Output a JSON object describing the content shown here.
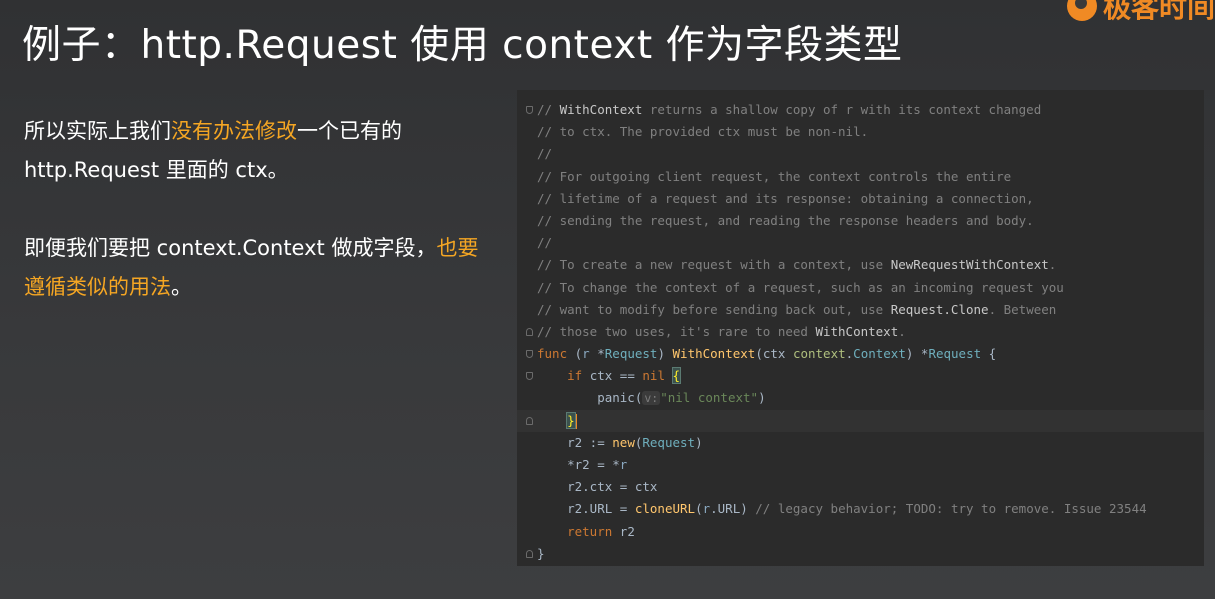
{
  "slide": {
    "title": "例子：http.Request 使用 context 作为字段类型",
    "logo_text": "极客时间"
  },
  "left": {
    "p1_a": "所以实际上我们",
    "p1_hl": "没有办法修改",
    "p1_b": "一个已有的 http.Request 里面的 ctx。",
    "p2_a": "即便我们要把 context.Context 做成字段，",
    "p2_hl": "也要遵循类似的用法",
    "p2_b": "。"
  },
  "colors": {
    "highlight": "#f5a623",
    "logo": "#f08a24",
    "code_bg": "#2b2b2b",
    "comment": "#808080",
    "keyword": "#cc7832",
    "type": "#6fafbd",
    "function": "#ffc66d",
    "string": "#6a8759"
  },
  "code": {
    "lines": [
      {
        "fold": "start",
        "current": false,
        "tokens": [
          {
            "t": "// ",
            "c": "comment"
          },
          {
            "t": "WithContext",
            "c": "ref"
          },
          {
            "t": " returns a shallow copy of r with its context changed",
            "c": "comment"
          }
        ]
      },
      {
        "fold": "",
        "current": false,
        "tokens": [
          {
            "t": "// to ctx. The provided ctx must be non-nil.",
            "c": "comment"
          }
        ]
      },
      {
        "fold": "",
        "current": false,
        "tokens": [
          {
            "t": "//",
            "c": "comment"
          }
        ]
      },
      {
        "fold": "",
        "current": false,
        "tokens": [
          {
            "t": "// For outgoing client request, the context controls the entire",
            "c": "comment"
          }
        ]
      },
      {
        "fold": "",
        "current": false,
        "tokens": [
          {
            "t": "// lifetime of a request and its response: obtaining a connection,",
            "c": "comment"
          }
        ]
      },
      {
        "fold": "",
        "current": false,
        "tokens": [
          {
            "t": "// sending the request, and reading the response headers and body.",
            "c": "comment"
          }
        ]
      },
      {
        "fold": "",
        "current": false,
        "tokens": [
          {
            "t": "//",
            "c": "comment"
          }
        ]
      },
      {
        "fold": "",
        "current": false,
        "tokens": [
          {
            "t": "// To create a new request with a context, use ",
            "c": "comment"
          },
          {
            "t": "NewRequestWithContext",
            "c": "ref"
          },
          {
            "t": ".",
            "c": "comment"
          }
        ]
      },
      {
        "fold": "",
        "current": false,
        "tokens": [
          {
            "t": "// To change the context of a request, such as an incoming request you",
            "c": "comment"
          }
        ]
      },
      {
        "fold": "",
        "current": false,
        "tokens": [
          {
            "t": "// want to modify before sending back out, use ",
            "c": "comment"
          },
          {
            "t": "Request.Clone",
            "c": "ref"
          },
          {
            "t": ". Between",
            "c": "comment"
          }
        ]
      },
      {
        "fold": "end",
        "current": false,
        "tokens": [
          {
            "t": "// those two uses, it's rare to need ",
            "c": "comment"
          },
          {
            "t": "WithContext",
            "c": "ref"
          },
          {
            "t": ".",
            "c": "comment"
          }
        ]
      },
      {
        "fold": "start",
        "current": false,
        "tokens": [
          {
            "t": "func",
            "c": "kw"
          },
          {
            "t": " (",
            "c": "plain"
          },
          {
            "t": "r",
            "c": "param"
          },
          {
            "t": " *",
            "c": "plain"
          },
          {
            "t": "Request",
            "c": "type"
          },
          {
            "t": ") ",
            "c": "plain"
          },
          {
            "t": "WithContext",
            "c": "fn"
          },
          {
            "t": "(ctx ",
            "c": "plain"
          },
          {
            "t": "context",
            "c": "pkg"
          },
          {
            "t": ".",
            "c": "plain"
          },
          {
            "t": "Context",
            "c": "type"
          },
          {
            "t": ") *",
            "c": "plain"
          },
          {
            "t": "Request",
            "c": "type"
          },
          {
            "t": " {",
            "c": "plain"
          }
        ]
      },
      {
        "fold": "start",
        "current": false,
        "tokens": [
          {
            "t": "    ",
            "c": "plain"
          },
          {
            "t": "if",
            "c": "kw"
          },
          {
            "t": " ctx == ",
            "c": "plain"
          },
          {
            "t": "nil",
            "c": "kw"
          },
          {
            "t": " ",
            "c": "plain"
          },
          {
            "t": "{",
            "c": "brace"
          }
        ]
      },
      {
        "fold": "",
        "current": false,
        "tokens": [
          {
            "t": "        panic(",
            "c": "plain"
          },
          {
            "t": "v:",
            "c": "hint"
          },
          {
            "t": "\"nil context\"",
            "c": "str"
          },
          {
            "t": ")",
            "c": "plain"
          }
        ]
      },
      {
        "fold": "end",
        "current": true,
        "tokens": [
          {
            "t": "    ",
            "c": "plain"
          },
          {
            "t": "}",
            "c": "brace"
          },
          {
            "t": "",
            "c": "caret"
          }
        ]
      },
      {
        "fold": "",
        "current": false,
        "tokens": [
          {
            "t": "    r2 := ",
            "c": "plain"
          },
          {
            "t": "new",
            "c": "fn"
          },
          {
            "t": "(",
            "c": "plain"
          },
          {
            "t": "Request",
            "c": "type"
          },
          {
            "t": ")",
            "c": "plain"
          }
        ]
      },
      {
        "fold": "",
        "current": false,
        "tokens": [
          {
            "t": "    *r2 = *",
            "c": "plain"
          },
          {
            "t": "r",
            "c": "param"
          }
        ]
      },
      {
        "fold": "",
        "current": false,
        "tokens": [
          {
            "t": "    r2.ctx = ctx",
            "c": "plain"
          }
        ]
      },
      {
        "fold": "",
        "current": false,
        "tokens": [
          {
            "t": "    r2.URL = ",
            "c": "plain"
          },
          {
            "t": "cloneURL",
            "c": "fn"
          },
          {
            "t": "(",
            "c": "plain"
          },
          {
            "t": "r",
            "c": "param"
          },
          {
            "t": ".URL) ",
            "c": "plain"
          },
          {
            "t": "// legacy behavior; TODO: try to remove. Issue 23544",
            "c": "comment"
          }
        ]
      },
      {
        "fold": "",
        "current": false,
        "tokens": [
          {
            "t": "    ",
            "c": "plain"
          },
          {
            "t": "return",
            "c": "kw"
          },
          {
            "t": " r2",
            "c": "plain"
          }
        ]
      },
      {
        "fold": "end",
        "current": false,
        "tokens": [
          {
            "t": "}",
            "c": "plain"
          }
        ]
      }
    ]
  }
}
